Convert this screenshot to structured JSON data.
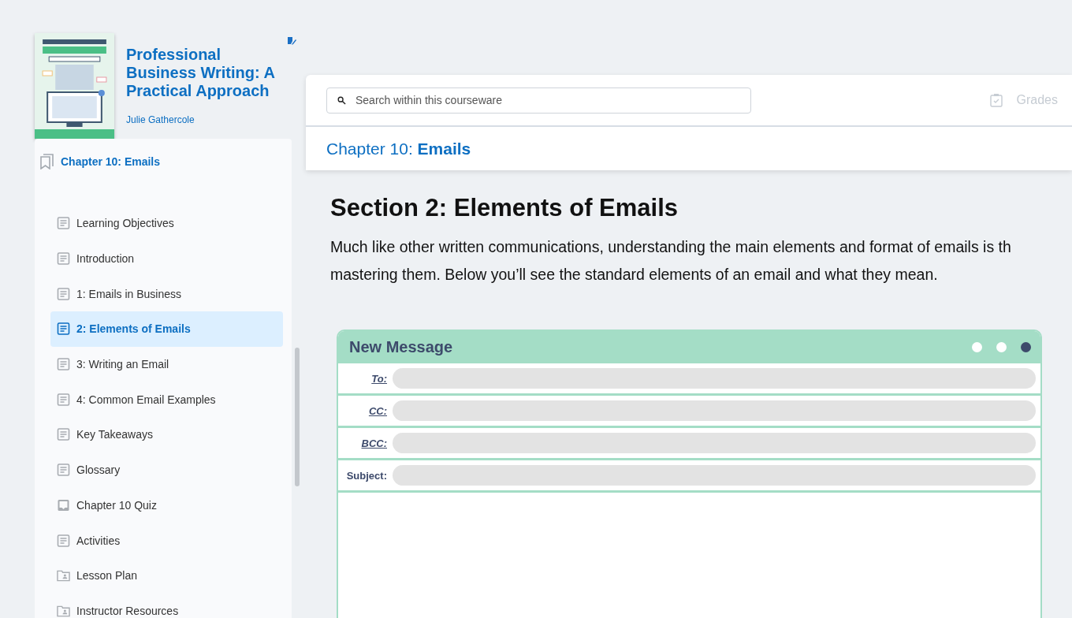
{
  "book": {
    "title": "Professional Business Writing: A Practical Approach",
    "author": "Julie Gathercole"
  },
  "outline": {
    "chapter": "Chapter 10: Emails",
    "items": [
      {
        "label": "Learning Objectives",
        "kind": "page",
        "selected": false
      },
      {
        "label": "Introduction",
        "kind": "page",
        "selected": false
      },
      {
        "label": "1: Emails in Business",
        "kind": "page",
        "selected": false
      },
      {
        "label": "2: Elements of Emails",
        "kind": "page",
        "selected": true
      },
      {
        "label": "3: Writing an Email",
        "kind": "page",
        "selected": false
      },
      {
        "label": "4: Common Email Examples",
        "kind": "page",
        "selected": false
      },
      {
        "label": "Key Takeaways",
        "kind": "page",
        "selected": false
      },
      {
        "label": "Glossary",
        "kind": "page",
        "selected": false
      },
      {
        "label": "Chapter 10 Quiz",
        "kind": "quiz",
        "selected": false
      },
      {
        "label": "Activities",
        "kind": "page",
        "selected": false
      },
      {
        "label": "Lesson Plan",
        "kind": "folder",
        "selected": false
      },
      {
        "label": "Instructor Resources",
        "kind": "folder",
        "selected": false
      }
    ]
  },
  "search": {
    "placeholder": "Search within this courseware"
  },
  "grades": {
    "label": "Grades",
    "disabled": true
  },
  "breadcrumb": {
    "prefix": "Chapter 10:",
    "current": "Emails"
  },
  "section": {
    "title": "Section 2: Elements of Emails",
    "lines": [
      "Much like other written communications, understanding the main elements and format of emails is th",
      "mastering them. Below you’ll see the standard elements of an email and what they mean."
    ]
  },
  "email": {
    "title": "New Message",
    "dots": [
      {
        "color": "#ffffff"
      },
      {
        "color": "#ffffff"
      },
      {
        "color": "#3d4a6b"
      }
    ],
    "fields": [
      {
        "label": "To:",
        "kind": "link"
      },
      {
        "label": "CC:",
        "kind": "link"
      },
      {
        "label": "BCC:",
        "kind": "link"
      },
      {
        "label": "Subject:",
        "kind": "plain"
      }
    ]
  }
}
